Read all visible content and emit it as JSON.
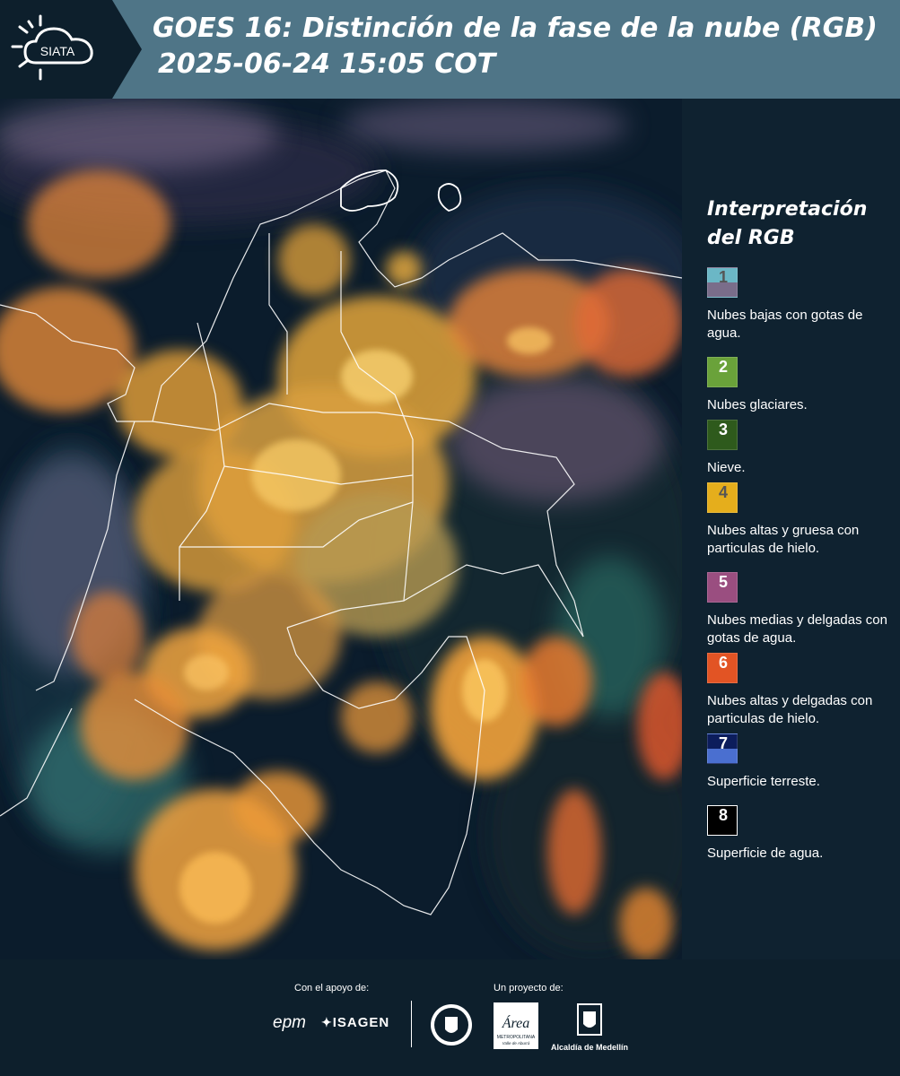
{
  "header": {
    "logo_text": "SIATA",
    "title_line1": "GOES 16: Distinción de la fase de la nube (RGB)",
    "title_line2": "2025-06-24 15:05 COT"
  },
  "image": {
    "description_icon": "satellite-rgb-map"
  },
  "legend": {
    "title": "Interpretación del RGB",
    "items": [
      {
        "num": "1",
        "label": "Nubes bajas con gotas de agua.",
        "color_top": "#6bb7c6",
        "color_bottom": "#7a6d8a",
        "num_color": "#555555"
      },
      {
        "num": "2",
        "label": "Nubes glaciares.",
        "color_top": "#6aa23a",
        "color_bottom": "#6aa23a",
        "num_color": "#ffffff"
      },
      {
        "num": "3",
        "label": "Nieve.",
        "color_top": "#2e5a1c",
        "color_bottom": "#2e5a1c",
        "num_color": "#ffffff"
      },
      {
        "num": "4",
        "label": "Nubes altas y gruesa con particulas de hielo.",
        "color_top": "#e5ae1c",
        "color_bottom": "#e5ae1c",
        "num_color": "#555555"
      },
      {
        "num": "5",
        "label": "Nubes medias y delgadas con gotas de agua.",
        "color_top": "#9a4e80",
        "color_bottom": "#9a4e80",
        "num_color": "#ffffff"
      },
      {
        "num": "6",
        "label": "Nubes altas y delgadas con particulas de hielo.",
        "color_top": "#e25424",
        "color_bottom": "#e25424",
        "num_color": "#ffffff"
      },
      {
        "num": "7",
        "label": "Superficie terreste.",
        "color_top": "#0c1d5c",
        "color_bottom": "#4a6fd0",
        "num_color": "#ffffff"
      },
      {
        "num": "8",
        "label": "Superficie de agua.",
        "color_top": "#000000",
        "color_bottom": "#000000",
        "num_color": "#ffffff"
      }
    ]
  },
  "footer": {
    "support_label": "Con el apoyo de:",
    "project_label": "Un proyecto de:",
    "epm": "epm",
    "isagen": "ISAGEN",
    "area_name": "Área",
    "area_sub": "METROPOLITANA",
    "area_sub2": "Valle de Aburrá",
    "alcaldia": "Alcaldía de Medellín"
  },
  "colors": {
    "header_bg": "#4f7587",
    "legend_bg": "#0f2230",
    "footer_bg": "#0d1f2c"
  }
}
